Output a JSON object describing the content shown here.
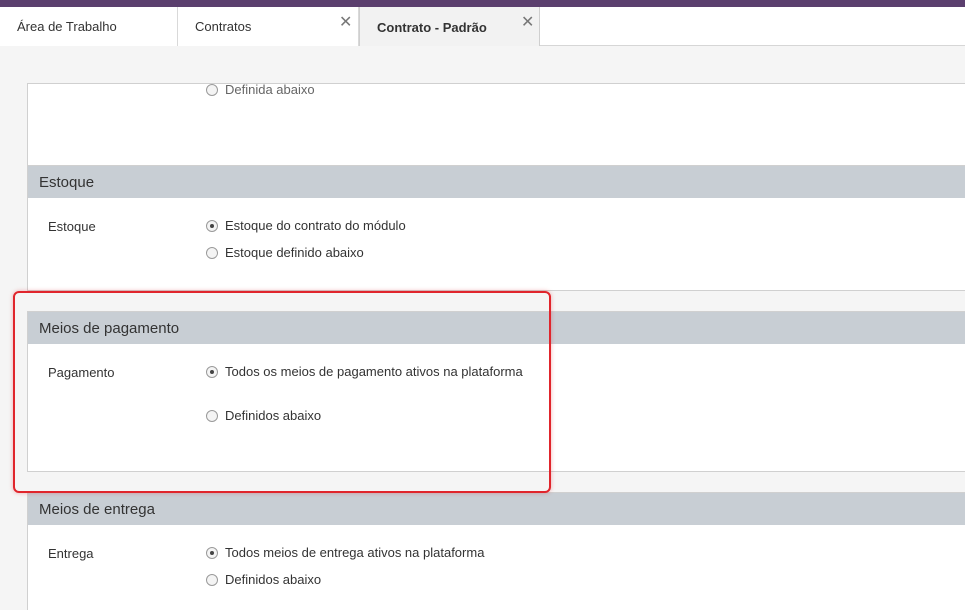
{
  "tabs": [
    {
      "label": "Área de Trabalho",
      "closable": false
    },
    {
      "label": "Contratos",
      "closable": true
    },
    {
      "label": "Contrato - Padrão",
      "closable": true,
      "active": true
    }
  ],
  "close_glyph": "✕",
  "sections": {
    "previous": {
      "options": [
        {
          "label": "Definida abaixo",
          "checked": false
        }
      ]
    },
    "estoque": {
      "title": "Estoque",
      "field_label": "Estoque",
      "options": [
        {
          "label": "Estoque do contrato do módulo",
          "checked": true
        },
        {
          "label": "Estoque definido abaixo",
          "checked": false
        }
      ]
    },
    "pagamento": {
      "title": "Meios de pagamento",
      "field_label": "Pagamento",
      "options": [
        {
          "label": "Todos os meios de pagamento ativos na plataforma",
          "checked": true
        },
        {
          "label": "Definidos abaixo",
          "checked": false
        }
      ]
    },
    "entrega": {
      "title": "Meios de entrega",
      "field_label": "Entrega",
      "options": [
        {
          "label": "Todos meios de entrega ativos na plataforma",
          "checked": true
        },
        {
          "label": "Definidos abaixo",
          "checked": false
        }
      ]
    }
  },
  "colors": {
    "topbar": "#5b3f6e",
    "panel_header": "#c8ced4",
    "highlight": "#e0252c"
  }
}
